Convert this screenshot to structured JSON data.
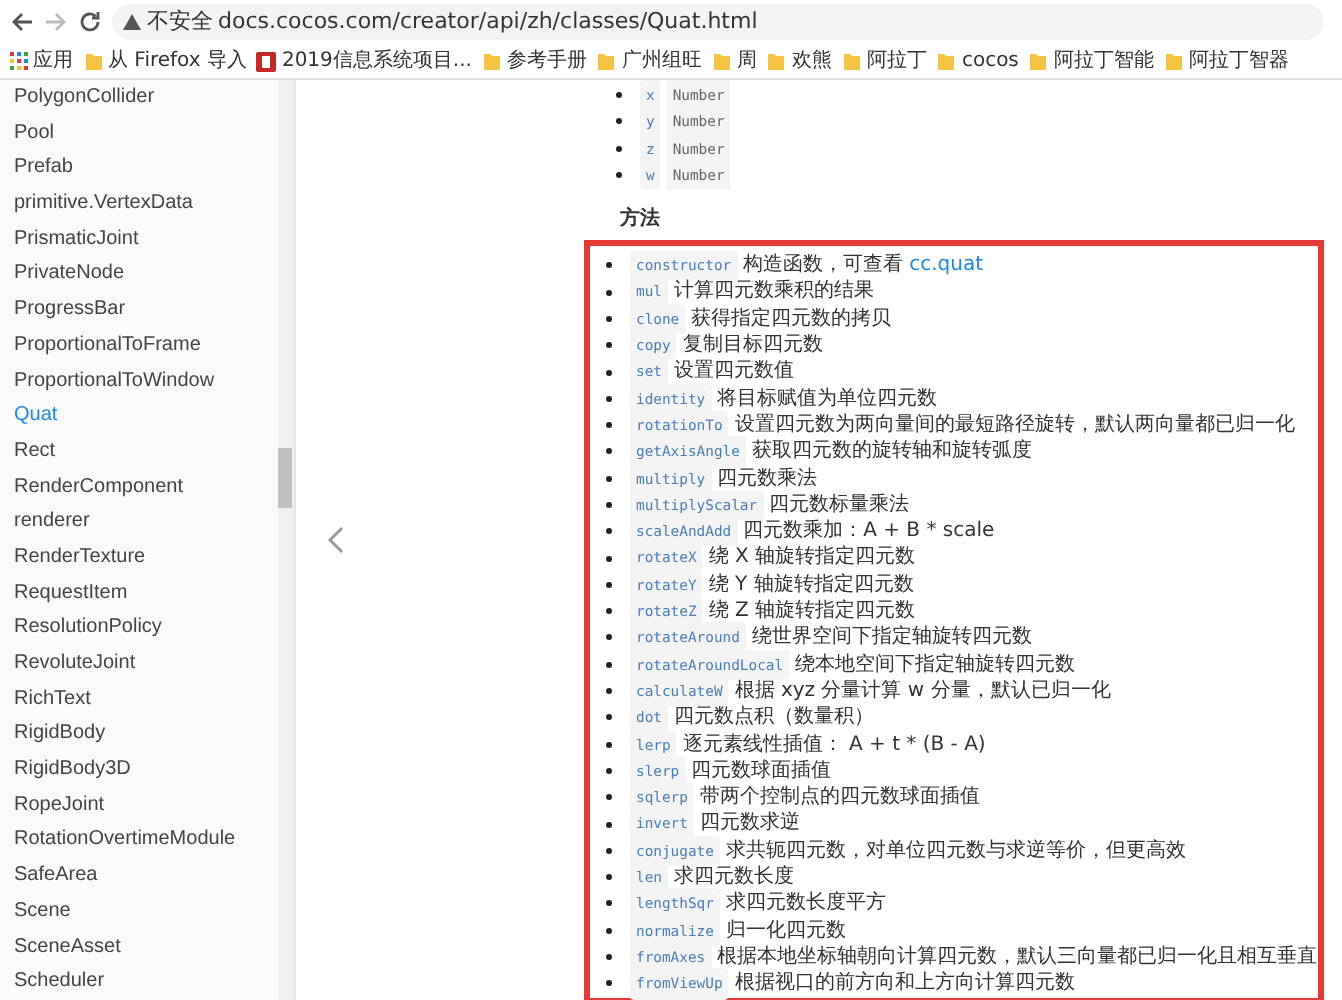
{
  "browser": {
    "security_label": "不安全",
    "url": "docs.cocos.com/creator/api/zh/classes/Quat.html"
  },
  "bookmarks": [
    {
      "label": "应用",
      "kind": "apps"
    },
    {
      "label": "从 Firefox 导入",
      "kind": "folder"
    },
    {
      "label": "2019信息系统项目...",
      "kind": "site"
    },
    {
      "label": "参考手册",
      "kind": "folder"
    },
    {
      "label": "广州组旺",
      "kind": "folder"
    },
    {
      "label": "周",
      "kind": "folder"
    },
    {
      "label": "欢熊",
      "kind": "folder"
    },
    {
      "label": "阿拉丁",
      "kind": "folder"
    },
    {
      "label": "cocos",
      "kind": "folder"
    },
    {
      "label": "阿拉丁智能",
      "kind": "folder"
    },
    {
      "label": "阿拉丁智器",
      "kind": "folder"
    }
  ],
  "sidebar": {
    "items": [
      {
        "label": "PolygonCollider",
        "selected": false
      },
      {
        "label": "Pool",
        "selected": false
      },
      {
        "label": "Prefab",
        "selected": false
      },
      {
        "label": "primitive.VertexData",
        "selected": false
      },
      {
        "label": "PrismaticJoint",
        "selected": false
      },
      {
        "label": "PrivateNode",
        "selected": false
      },
      {
        "label": "ProgressBar",
        "selected": false
      },
      {
        "label": "ProportionalToFrame",
        "selected": false
      },
      {
        "label": "ProportionalToWindow",
        "selected": false
      },
      {
        "label": "Quat",
        "selected": true
      },
      {
        "label": "Rect",
        "selected": false
      },
      {
        "label": "RenderComponent",
        "selected": false
      },
      {
        "label": "renderer",
        "selected": false
      },
      {
        "label": "RenderTexture",
        "selected": false
      },
      {
        "label": "RequestItem",
        "selected": false
      },
      {
        "label": "ResolutionPolicy",
        "selected": false
      },
      {
        "label": "RevoluteJoint",
        "selected": false
      },
      {
        "label": "RichText",
        "selected": false
      },
      {
        "label": "RigidBody",
        "selected": false
      },
      {
        "label": "RigidBody3D",
        "selected": false
      },
      {
        "label": "RopeJoint",
        "selected": false
      },
      {
        "label": "RotationOvertimeModule",
        "selected": false
      },
      {
        "label": "SafeArea",
        "selected": false
      },
      {
        "label": "Scene",
        "selected": false
      },
      {
        "label": "SceneAsset",
        "selected": false
      },
      {
        "label": "Scheduler",
        "selected": false
      }
    ]
  },
  "properties": [
    {
      "name": "x",
      "type": "Number"
    },
    {
      "name": "y",
      "type": "Number"
    },
    {
      "name": "z",
      "type": "Number"
    },
    {
      "name": "w",
      "type": "Number"
    }
  ],
  "methods_heading": "方法",
  "methods": [
    {
      "name": "constructor",
      "desc": "构造函数，可查看",
      "link": "cc.quat"
    },
    {
      "name": "mul",
      "desc": "计算四元数乘积的结果"
    },
    {
      "name": "clone",
      "desc": "获得指定四元数的拷贝"
    },
    {
      "name": "copy",
      "desc": "复制目标四元数"
    },
    {
      "name": "set",
      "desc": "设置四元数值"
    },
    {
      "name": "identity",
      "desc": "将目标赋值为单位四元数"
    },
    {
      "name": "rotationTo",
      "desc": "设置四元数为两向量间的最短路径旋转，默认两向量都已归一化"
    },
    {
      "name": "getAxisAngle",
      "desc": "获取四元数的旋转轴和旋转弧度"
    },
    {
      "name": "multiply",
      "desc": "四元数乘法"
    },
    {
      "name": "multiplyScalar",
      "desc": "四元数标量乘法"
    },
    {
      "name": "scaleAndAdd",
      "desc": "四元数乘加：A + B * scale"
    },
    {
      "name": "rotateX",
      "desc": "绕 X 轴旋转指定四元数"
    },
    {
      "name": "rotateY",
      "desc": "绕 Y 轴旋转指定四元数"
    },
    {
      "name": "rotateZ",
      "desc": "绕 Z 轴旋转指定四元数"
    },
    {
      "name": "rotateAround",
      "desc": "绕世界空间下指定轴旋转四元数"
    },
    {
      "name": "rotateAroundLocal",
      "desc": "绕本地空间下指定轴旋转四元数"
    },
    {
      "name": "calculateW",
      "desc": "根据 xyz 分量计算 w 分量，默认已归一化"
    },
    {
      "name": "dot",
      "desc": "四元数点积（数量积）"
    },
    {
      "name": "lerp",
      "desc": "逐元素线性插值： A + t * (B - A)"
    },
    {
      "name": "slerp",
      "desc": "四元数球面插值"
    },
    {
      "name": "sqlerp",
      "desc": "带两个控制点的四元数球面插值"
    },
    {
      "name": "invert",
      "desc": "四元数求逆"
    },
    {
      "name": "conjugate",
      "desc": "求共轭四元数，对单位四元数与求逆等价，但更高效"
    },
    {
      "name": "len",
      "desc": "求四元数长度"
    },
    {
      "name": "lengthSqr",
      "desc": "求四元数长度平方"
    },
    {
      "name": "normalize",
      "desc": "归一化四元数"
    },
    {
      "name": "fromAxes",
      "desc": "根据本地坐标轴朝向计算四元数，默认三向量都已归一化且相互垂直"
    },
    {
      "name": "fromViewUp",
      "desc": "根据视口的前方向和上方向计算四元数"
    }
  ]
}
